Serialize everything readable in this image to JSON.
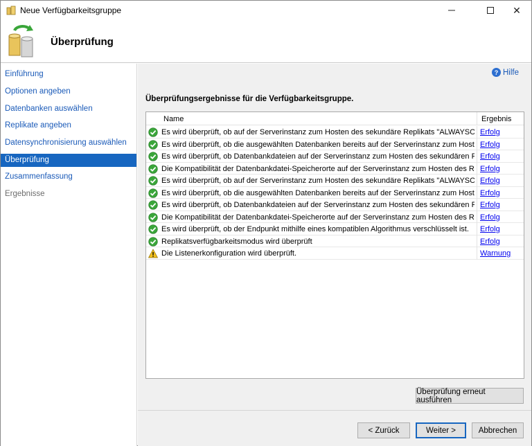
{
  "window": {
    "title": "Neue Verfügbarkeitsgruppe",
    "close_glyph": "✕"
  },
  "header": {
    "title": "Überprüfung"
  },
  "nav": {
    "items": [
      {
        "label": "Einführung",
        "state": "link"
      },
      {
        "label": "Optionen angeben",
        "state": "link"
      },
      {
        "label": "Datenbanken auswählen",
        "state": "link"
      },
      {
        "label": "Replikate angeben",
        "state": "link"
      },
      {
        "label": "Datensynchronisierung auswählen",
        "state": "link"
      },
      {
        "label": "Überprüfung",
        "state": "active"
      },
      {
        "label": "Zusammenfassung",
        "state": "link"
      },
      {
        "label": "Ergebnisse",
        "state": "disabled"
      }
    ]
  },
  "help": {
    "label": "Hilfe"
  },
  "results": {
    "heading": "Überprüfungsergebnisse für die Verfügbarkeitsgruppe.",
    "columns": {
      "name": "Name",
      "result": "Ergebnis"
    },
    "rows": [
      {
        "status": "success",
        "name": "Es wird überprüft, ob auf der Serverinstanz zum Hosten des sekundäre Replikats \"ALWAYSONSQ...",
        "result": "Erfolg"
      },
      {
        "status": "success",
        "name": "Es wird überprüft, ob die ausgewählten Datenbanken bereits auf der Serverinstanz zum Hosten ...",
        "result": "Erfolg"
      },
      {
        "status": "success",
        "name": "Es wird überprüft, ob Datenbankdateien auf der Serverinstanz zum Hosten des sekundären Repli...",
        "result": "Erfolg"
      },
      {
        "status": "success",
        "name": "Die Kompatibilität der Datenbankdatei-Speicherorte auf der Serverinstanz zum Hosten des Repli...",
        "result": "Erfolg"
      },
      {
        "status": "success",
        "name": "Es wird überprüft, ob auf der Serverinstanz zum Hosten des sekundäre Replikats \"ALWAYSONSQ...",
        "result": "Erfolg"
      },
      {
        "status": "success",
        "name": "Es wird überprüft, ob die ausgewählten Datenbanken bereits auf der Serverinstanz zum Hosten ...",
        "result": "Erfolg"
      },
      {
        "status": "success",
        "name": "Es wird überprüft, ob Datenbankdateien auf der Serverinstanz zum Hosten des sekundären Repli...",
        "result": "Erfolg"
      },
      {
        "status": "success",
        "name": "Die Kompatibilität der Datenbankdatei-Speicherorte auf der Serverinstanz zum Hosten des Repli...",
        "result": "Erfolg"
      },
      {
        "status": "success",
        "name": "Es wird überprüft, ob der Endpunkt mithilfe eines kompatiblen Algorithmus verschlüsselt ist.",
        "result": "Erfolg"
      },
      {
        "status": "success",
        "name": "Replikatsverfügbarkeitsmodus wird überprüft",
        "result": "Erfolg"
      },
      {
        "status": "warning",
        "name": "Die Listenerkonfiguration wird überprüft.",
        "result": "Warnung"
      }
    ]
  },
  "buttons": {
    "rerun": "Überprüfung erneut ausführen",
    "back": "< Zurück",
    "next": "Weiter >",
    "cancel": "Abbrechen"
  },
  "colors": {
    "link": "#1a5ab8",
    "nav_active_bg": "#1766c0",
    "success": "#3aa63a",
    "warning": "#f2c01e"
  }
}
